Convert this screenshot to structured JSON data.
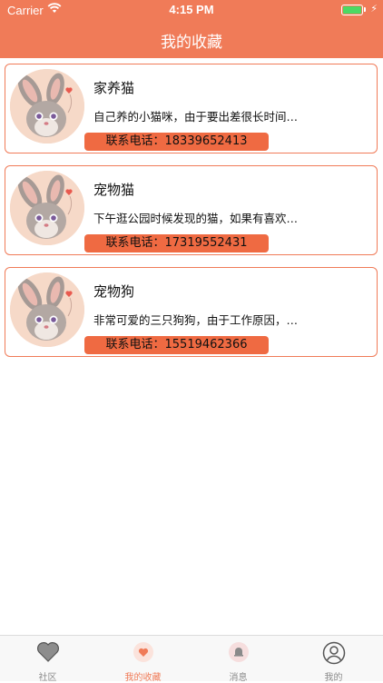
{
  "status_bar": {
    "carrier": "Carrier",
    "time": "4:15 PM"
  },
  "header": {
    "title": "我的收藏"
  },
  "favorites": [
    {
      "name": "家养猫",
      "description": "自己养的小猫咪，由于要出差很长时间…",
      "phone": "联系电话：18339652413"
    },
    {
      "name": "宠物猫",
      "description": "下午逛公园时候发现的猫，如果有喜欢…",
      "phone": "联系电话：17319552431"
    },
    {
      "name": "宠物狗",
      "description": "非常可爱的三只狗狗，由于工作原因，…",
      "phone": "联系电话：15519462366"
    }
  ],
  "tabbar": {
    "items": [
      {
        "label": "社区",
        "icon": "heart-icon"
      },
      {
        "label": "我的收藏",
        "icon": "favorite-heart-icon"
      },
      {
        "label": "消息",
        "icon": "bell-icon"
      },
      {
        "label": "我的",
        "icon": "user-icon"
      }
    ],
    "active_index": 1
  },
  "colors": {
    "accent": "#f07b58",
    "phone_pill": "#ef6a42"
  }
}
